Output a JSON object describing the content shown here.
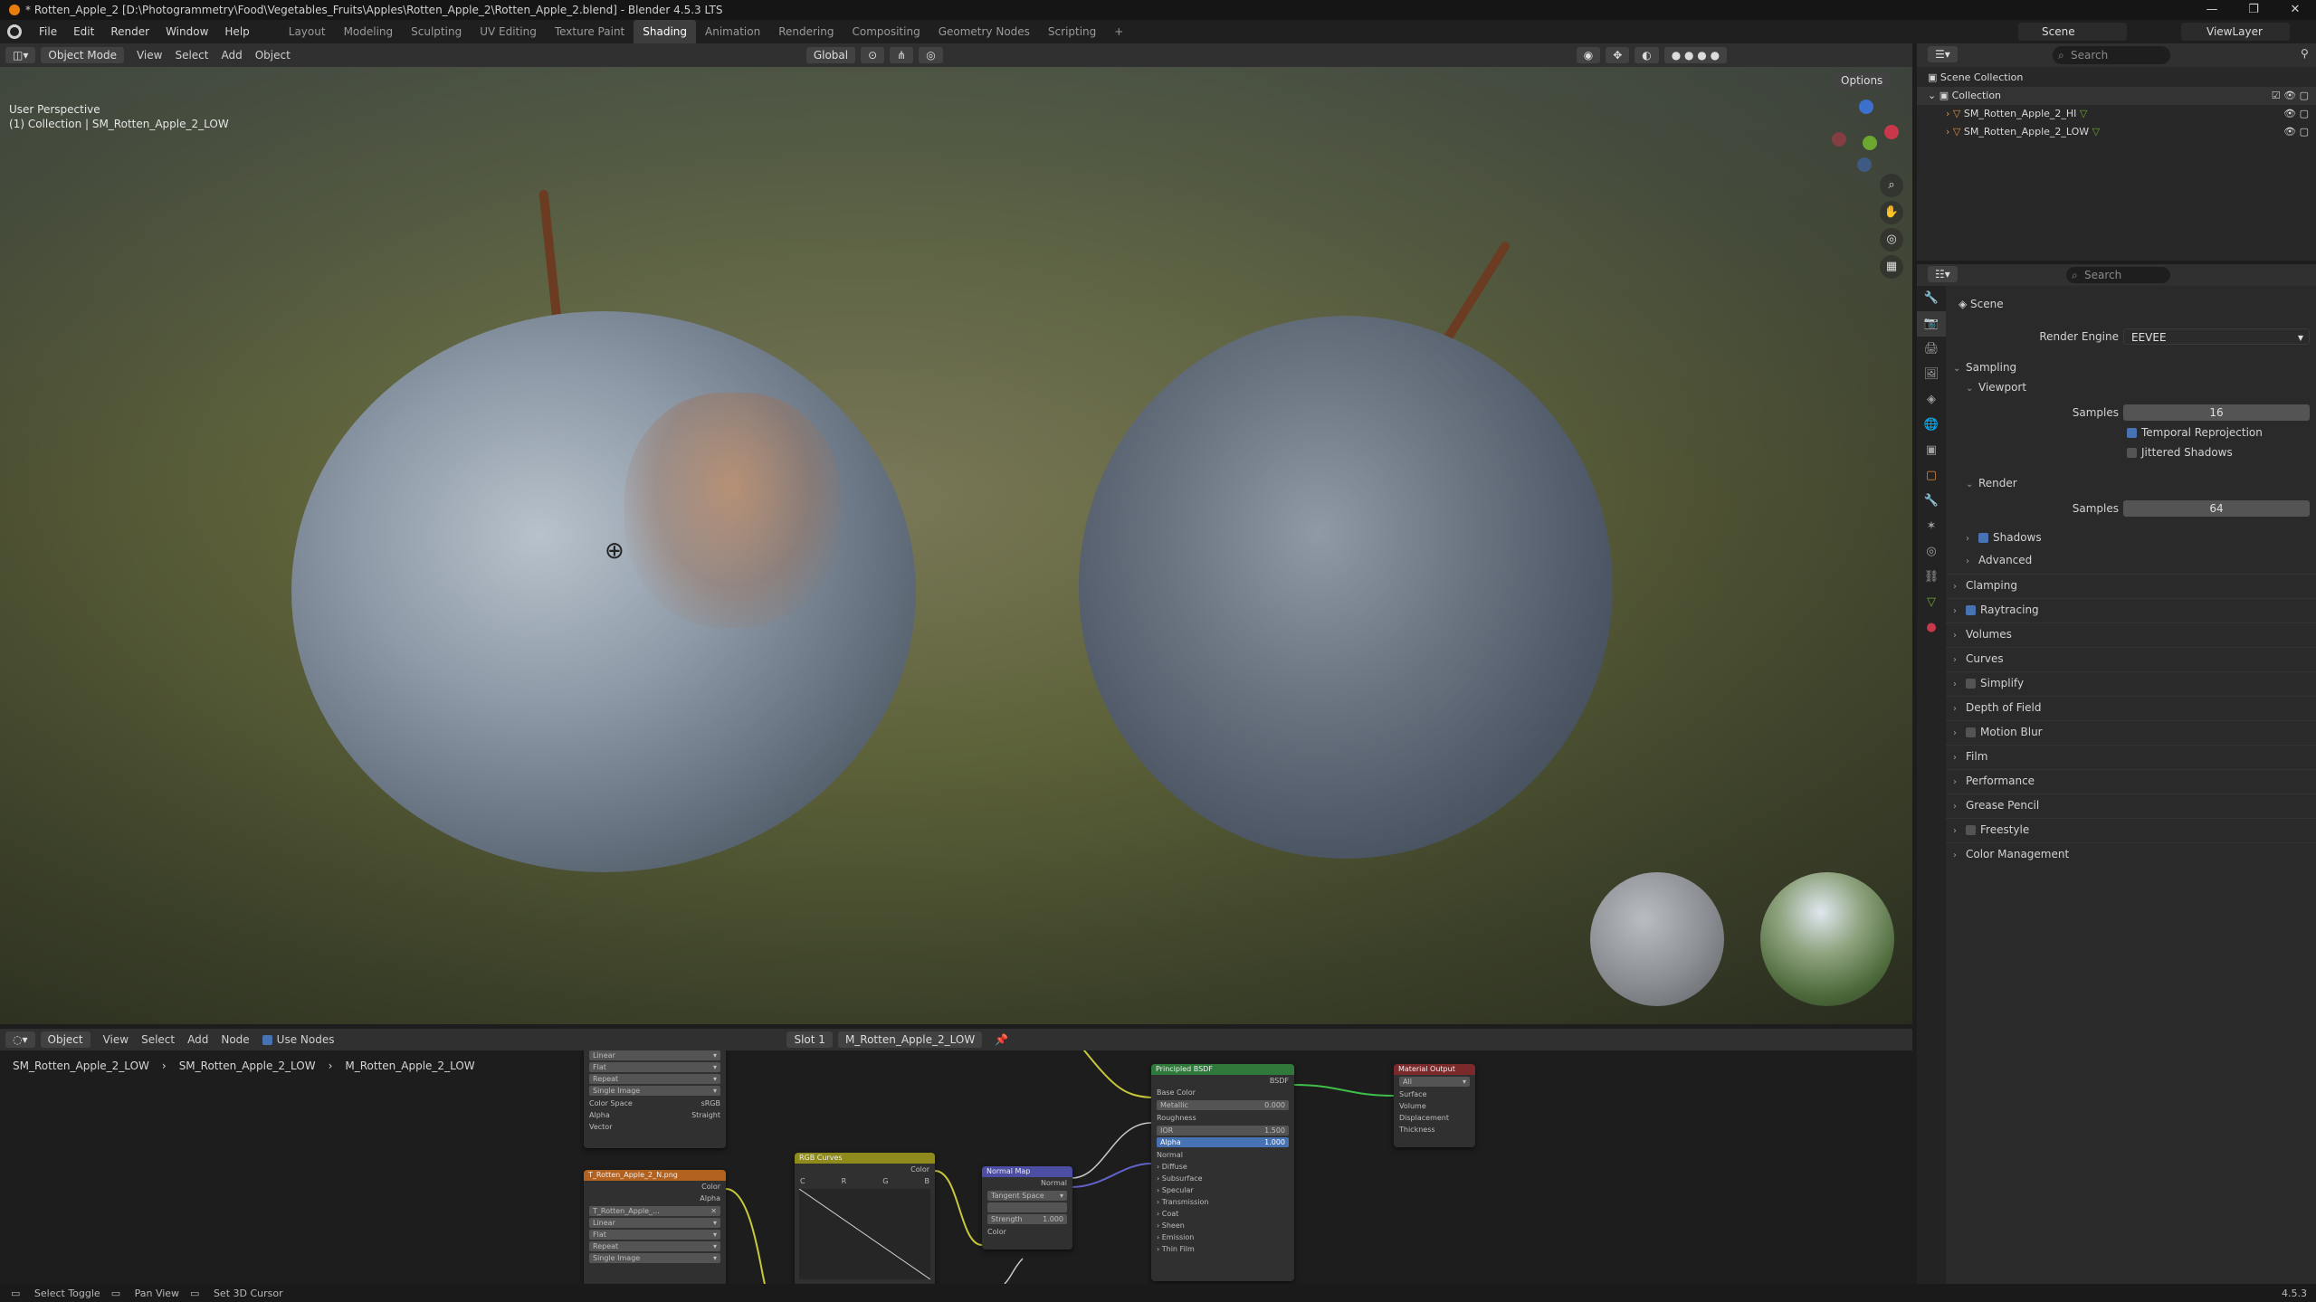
{
  "window": {
    "title": "* Rotten_Apple_2 [D:\\Photogrammetry\\Food\\Vegetables_Fruits\\Apples\\Rotten_Apple_2\\Rotten_Apple_2.blend] - Blender 4.5.3 LTS",
    "controls": [
      "—",
      "❐",
      "✕"
    ]
  },
  "menu": [
    "File",
    "Edit",
    "Render",
    "Window",
    "Help"
  ],
  "workspaces": [
    "Layout",
    "Modeling",
    "Sculpting",
    "UV Editing",
    "Texture Paint",
    "Shading",
    "Animation",
    "Rendering",
    "Compositing",
    "Geometry Nodes",
    "Scripting",
    "+"
  ],
  "active_workspace": "Shading",
  "scene_name": "Scene",
  "view_layer": "ViewLayer",
  "viewport": {
    "mode": "Object Mode",
    "menus": [
      "View",
      "Select",
      "Add",
      "Object"
    ],
    "transform": "Global",
    "options": "Options",
    "perspective_label": "User Perspective",
    "collection_label": "(1) Collection | SM_Rotten_Apple_2_LOW",
    "gizmo_axes": [
      "X",
      "Y",
      "Z"
    ]
  },
  "node_editor": {
    "type": "Object",
    "menus": [
      "View",
      "Select",
      "Add",
      "Node"
    ],
    "use_nodes_label": "Use Nodes",
    "slot": "Slot 1",
    "material": "M_Rotten_Apple_2_LOW",
    "breadcrumb": [
      "SM_Rotten_Apple_2_LOW",
      "SM_Rotten_Apple_2_LOW",
      "M_Rotten_Apple_2_LOW"
    ],
    "image_node_top": {
      "rows": [
        "Linear",
        "Flat",
        "Repeat",
        "Single Image"
      ],
      "color_space_label": "Color Space",
      "color_space": "sRGB",
      "alpha_label": "Alpha",
      "alpha": "Straight",
      "vector": "Vector"
    },
    "image_node_bottom": {
      "title": "T_Rotten_Apple_2_N.png",
      "outputs": [
        "Color",
        "Alpha"
      ],
      "file": "T_Rotten_Apple_...",
      "rows": [
        "Linear",
        "Flat",
        "Repeat",
        "Single Image"
      ]
    },
    "rgb_curves": {
      "title": "RGB Curves",
      "output": "Color",
      "channels": [
        "C",
        "R",
        "G",
        "B"
      ]
    },
    "normal_map": {
      "title": "Normal Map",
      "output": "Normal",
      "space": "Tangent Space",
      "strength_label": "Strength",
      "strength": "1.000",
      "input": "Color"
    },
    "bsdf": {
      "title": "Principled BSDF",
      "output": "BSDF",
      "base_color": "Base Color",
      "metallic_label": "Metallic",
      "metallic": "0.000",
      "roughness": "Roughness",
      "ior_label": "IOR",
      "ior": "1.500",
      "alpha_label": "Alpha",
      "alpha": "1.000",
      "normal": "Normal",
      "panels": [
        "Diffuse",
        "Subsurface",
        "Specular",
        "Transmission",
        "Coat",
        "Sheen",
        "Emission",
        "Thin Film"
      ]
    },
    "material_output": {
      "title": "Material Output",
      "target": "All",
      "inputs": [
        "Surface",
        "Volume",
        "Displacement",
        "Thickness"
      ]
    }
  },
  "outliner": {
    "search_placeholder": "Search",
    "scene_collection": "Scene Collection",
    "collection": "Collection",
    "objects": [
      "SM_Rotten_Apple_2_HI",
      "SM_Rotten_Apple_2_LOW"
    ]
  },
  "properties": {
    "search_placeholder": "Search",
    "context": "Scene",
    "render_engine_label": "Render Engine",
    "render_engine": "EEVEE",
    "sampling": "Sampling",
    "viewport": "Viewport",
    "samples_label": "Samples",
    "viewport_samples": "16",
    "temporal_reprojection": "Temporal Reprojection",
    "jittered_shadows": "Jittered Shadows",
    "render": "Render",
    "render_samples": "64",
    "shadows": "Shadows",
    "advanced": "Advanced",
    "panels": [
      "Clamping",
      "Raytracing",
      "Volumes",
      "Curves",
      "Simplify",
      "Depth of Field",
      "Motion Blur",
      "Film",
      "Performance",
      "Grease Pencil",
      "Freestyle",
      "Color Management"
    ]
  },
  "statusbar": {
    "items": [
      "Select Toggle",
      "Pan View",
      "Set 3D Cursor"
    ],
    "version": "4.5.3"
  },
  "colors": {
    "accent_blue": "#4772b3",
    "shader_green": "#2f7a3a",
    "image_orange": "#b3611f",
    "curves_yellow": "#8f8a1c",
    "normal_purple": "#4b4ea3",
    "output_red": "#7a2a2a"
  }
}
